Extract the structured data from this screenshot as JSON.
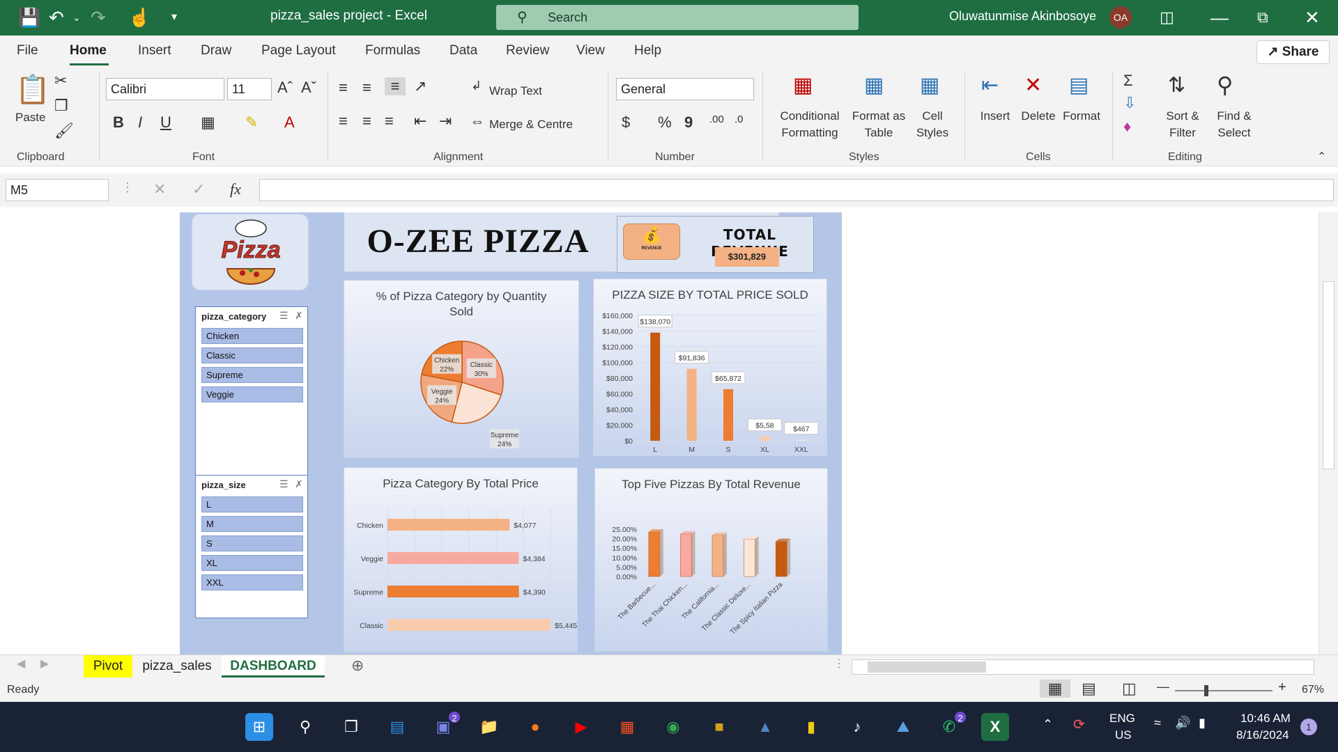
{
  "titlebar": {
    "doc_title": "pizza_sales project  -  Excel",
    "search_placeholder": "Search",
    "user_name": "Oluwatunmise Akinbosoye",
    "user_initials": "OA"
  },
  "menu": {
    "tabs": [
      "File",
      "Home",
      "Insert",
      "Draw",
      "Page Layout",
      "Formulas",
      "Data",
      "Review",
      "View",
      "Help"
    ],
    "active": "Home",
    "share_label": "Share"
  },
  "ribbon": {
    "clipboard": {
      "paste_label": "Paste",
      "group_label": "Clipboard"
    },
    "font": {
      "name": "Calibri",
      "size": "11",
      "group_label": "Font",
      "bold": "B",
      "italic": "I",
      "underline": "U"
    },
    "alignment": {
      "wrap_text": "Wrap Text",
      "merge_centre": "Merge & Centre",
      "group_label": "Alignment"
    },
    "number": {
      "format": "General",
      "currency": "$",
      "percent": "%",
      "comma": "9",
      "group_label": "Number"
    },
    "styles": {
      "conditional_1": "Conditional",
      "conditional_2": "Formatting",
      "format_as_1": "Format as",
      "format_as_2": "Table",
      "cell_styles_1": "Cell",
      "cell_styles_2": "Styles",
      "group_label": "Styles"
    },
    "cells": {
      "insert": "Insert",
      "delete": "Delete",
      "format": "Format",
      "group_label": "Cells"
    },
    "editing": {
      "sort_1": "Sort &",
      "sort_2": "Filter",
      "find_1": "Find &",
      "find_2": "Select",
      "group_label": "Editing"
    }
  },
  "formula_bar": {
    "name_box": "M5",
    "fx": "fx",
    "formula": ""
  },
  "dashboard": {
    "title": "O-ZEE  PIZZA",
    "logo_text": "Pizza",
    "revenue_icon_caption": "REVENUE",
    "total_revenue_label": "TOTAL REVENUE",
    "total_revenue_value": "$301,829",
    "slicer_category": {
      "header": "pizza_category",
      "items": [
        "Chicken",
        "Classic",
        "Supreme",
        "Veggie"
      ]
    },
    "slicer_size": {
      "header": "pizza_size",
      "items": [
        "L",
        "M",
        "S",
        "XL",
        "XXL"
      ]
    }
  },
  "chart_data": [
    {
      "type": "pie",
      "title": "% of Pizza Category by Quantity Sold",
      "categories": [
        "Chicken",
        "Classic",
        "Supreme",
        "Veggie"
      ],
      "values": [
        22,
        30,
        24,
        24
      ],
      "data_labels": [
        "22%",
        "30%",
        "24%",
        "24%"
      ],
      "colors": [
        "#ed7d31",
        "#f4a38a",
        "#fbe3d6",
        "#f0a97e"
      ]
    },
    {
      "type": "bar",
      "title": "PIZZA SIZE BY TOTAL PRICE SOLD",
      "categories": [
        "L",
        "M",
        "S",
        "XL",
        "XXL"
      ],
      "values": [
        138070,
        91836,
        65872,
        5580,
        467
      ],
      "data_labels": [
        "$138,070",
        "$91,836",
        "$65,872",
        "$5,58",
        "$467"
      ],
      "ylim": [
        0,
        160000
      ],
      "yticks": [
        "$0",
        "$20,000",
        "$40,000",
        "$60,000",
        "$80,000",
        "$100,000",
        "$120,000",
        "$140,000",
        "$160,000"
      ],
      "colors": [
        "#c55a11",
        "#f4b183",
        "#ed7d31",
        "#f8cbad",
        "#fbe5d6"
      ]
    },
    {
      "type": "bar",
      "orientation": "horizontal",
      "title": "Pizza Category By Total Price",
      "categories": [
        "Chicken",
        "Veggie",
        "Supreme",
        "Classic"
      ],
      "values": [
        4077,
        4384,
        4390,
        5445
      ],
      "data_labels": [
        "$4,077",
        "$4,384",
        "$4,390",
        "$5,445"
      ],
      "xlim": [
        0,
        5445
      ],
      "colors": [
        "#f4b183",
        "#f8a9a0",
        "#ed7d31",
        "#f8cbad"
      ]
    },
    {
      "type": "bar",
      "title": "Top Five Pizzas By Total Revenue",
      "categories": [
        "The Barbecue...",
        "The Thai Chicken...",
        "The California...",
        "The Classic Deluxe...",
        "The Spicy Italian Pizza"
      ],
      "values": [
        23.5,
        22.5,
        21.8,
        19.8,
        18.5
      ],
      "ylim": [
        0,
        25
      ],
      "yticks": [
        "0.00%",
        "5.00%",
        "10.00%",
        "15.00%",
        "20.00%",
        "25.00%"
      ],
      "colors": [
        "#ed7d31",
        "#f8a9a0",
        "#f4b183",
        "#fbe5d6",
        "#c55a11"
      ]
    }
  ],
  "sheet_tabs": {
    "tabs": [
      "Pivot",
      "pizza_sales",
      "DASHBOARD"
    ],
    "active": "DASHBOARD"
  },
  "status": {
    "mode": "Ready",
    "zoom": "67%"
  },
  "taskbar": {
    "lang_1": "ENG",
    "lang_2": "US",
    "time": "10:46 AM",
    "date": "8/16/2024",
    "notif_count": "1",
    "teams_badge": "2",
    "whatsapp_badge": "2"
  }
}
